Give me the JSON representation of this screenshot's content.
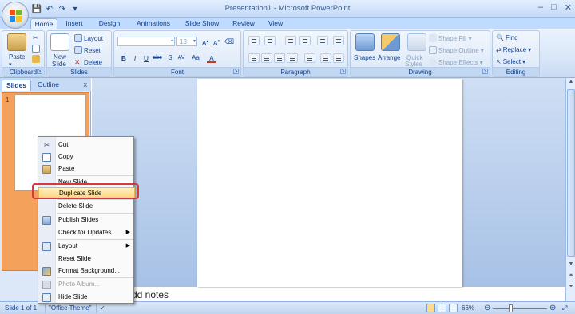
{
  "window": {
    "title": "Presentation1 - Microsoft PowerPoint",
    "controls": [
      "–",
      "□",
      "✕"
    ]
  },
  "qat": [
    "save-icon",
    "undo-icon",
    "redo-icon",
    "customize-qat-icon"
  ],
  "tabs": [
    "Home",
    "Insert",
    "Design",
    "Animations",
    "Slide Show",
    "Review",
    "View"
  ],
  "ribbon": {
    "clipboard": {
      "label": "Clipboard",
      "paste": "Paste"
    },
    "slides": {
      "label": "Slides",
      "new_slide_l1": "New",
      "new_slide_l2": "Slide",
      "layout": "Layout",
      "reset": "Reset",
      "delete": "Delete"
    },
    "font": {
      "label": "Font",
      "size": "18"
    },
    "paragraph": {
      "label": "Paragraph"
    },
    "drawing": {
      "label": "Drawing",
      "shapes": "Shapes",
      "arrange": "Arrange",
      "quick_styles_l1": "Quick",
      "quick_styles_l2": "Styles",
      "shape_fill": "Shape Fill",
      "shape_outline": "Shape Outline",
      "shape_effects": "Shape Effects"
    },
    "editing": {
      "label": "Editing",
      "find": "Find",
      "replace": "Replace",
      "select": "Select"
    }
  },
  "pane": {
    "tab_slides": "Slides",
    "tab_outline": "Outline",
    "close": "x",
    "slide_number": "1"
  },
  "notes": {
    "placeholder": "dd notes"
  },
  "status": {
    "slide_info": "Slide 1 of 1",
    "theme": "\"Office Theme\"",
    "zoom": "66%",
    "zoom_fraction": 0.33
  },
  "context_menu": {
    "items": [
      {
        "label": "Cut",
        "icon": "scissors-icon",
        "disabled": false,
        "submenu": false,
        "highlight": false
      },
      {
        "label": "Copy",
        "icon": "copy-icon",
        "disabled": false,
        "submenu": false,
        "highlight": false
      },
      {
        "label": "Paste",
        "icon": "paste-icon",
        "disabled": false,
        "submenu": false,
        "highlight": false
      },
      {
        "label": "New Slide",
        "icon": "",
        "disabled": false,
        "submenu": false,
        "highlight": false
      },
      {
        "label": "Duplicate Slide",
        "icon": "",
        "disabled": false,
        "submenu": false,
        "highlight": true
      },
      {
        "label": "Delete Slide",
        "icon": "",
        "disabled": false,
        "submenu": false,
        "highlight": false
      },
      {
        "label": "Publish Slides",
        "icon": "publish-icon",
        "disabled": false,
        "submenu": false,
        "highlight": false
      },
      {
        "label": "Check for Updates",
        "icon": "",
        "disabled": false,
        "submenu": true,
        "highlight": false
      },
      {
        "label": "Layout",
        "icon": "layout-icon",
        "disabled": false,
        "submenu": true,
        "highlight": false
      },
      {
        "label": "Reset Slide",
        "icon": "",
        "disabled": false,
        "submenu": false,
        "highlight": false
      },
      {
        "label": "Format Background...",
        "icon": "format-background-icon",
        "disabled": false,
        "submenu": false,
        "highlight": false
      },
      {
        "label": "Photo Album...",
        "icon": "photo-album-icon",
        "disabled": true,
        "submenu": false,
        "highlight": false
      },
      {
        "label": "Hide Slide",
        "icon": "hide-slide-icon",
        "disabled": false,
        "submenu": false,
        "highlight": false
      }
    ]
  },
  "colors": {
    "ribbon_text": "#15428b",
    "slide_thumb_highlight": "#f4a25b",
    "menu_highlight": "#ffd47a",
    "annotation_box": "#d9363e"
  }
}
